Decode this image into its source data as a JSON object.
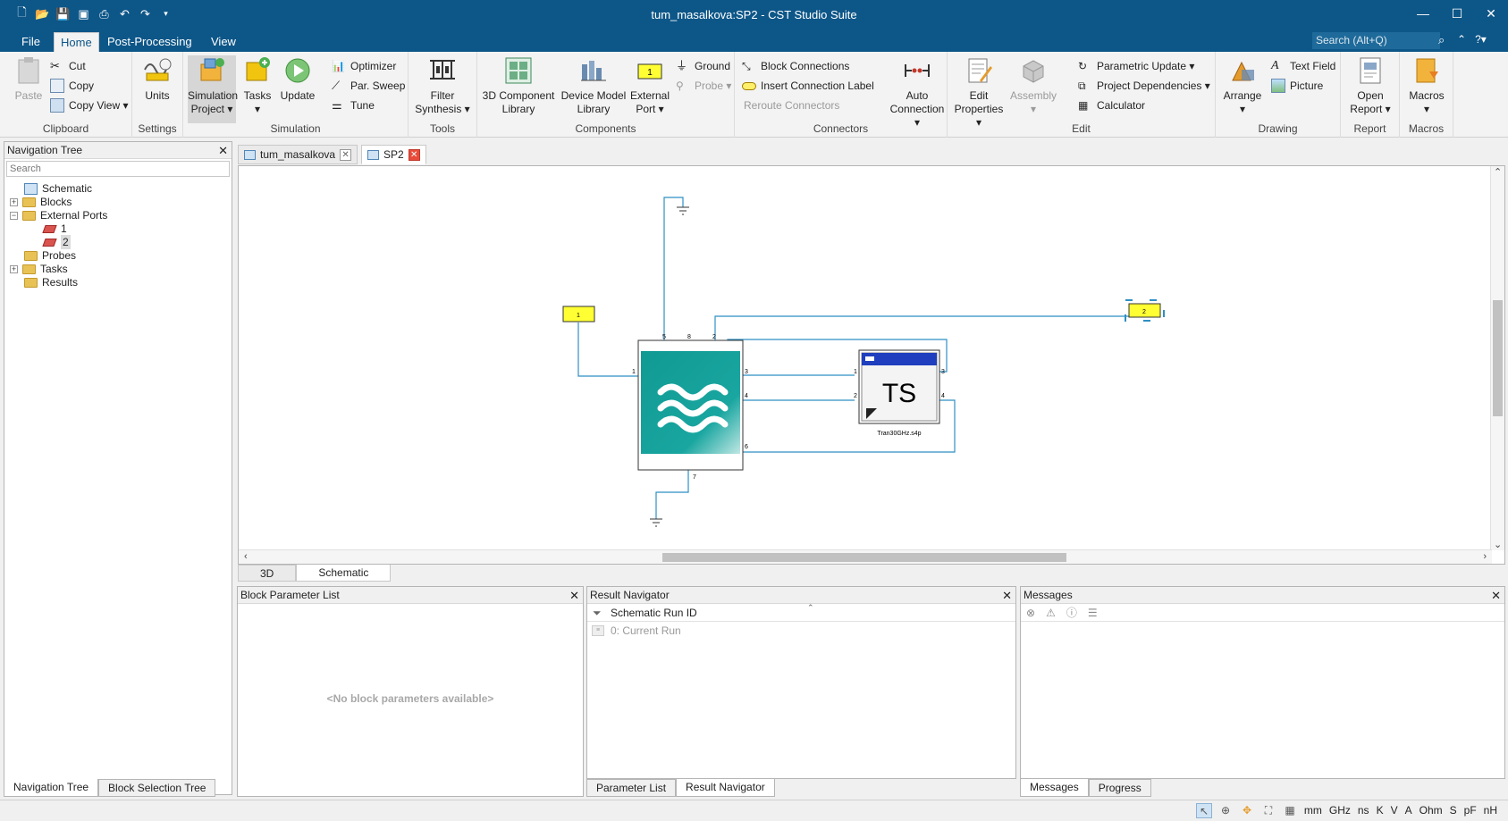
{
  "window": {
    "title": "tum_masalkova:SP2 - CST Studio Suite"
  },
  "menu": {
    "tabs": [
      "File",
      "Home",
      "Post-Processing",
      "View"
    ],
    "active": "Home",
    "search_placeholder": "Search (Alt+Q)"
  },
  "ribbon": {
    "clipboard": {
      "paste": "Paste",
      "cut": "Cut",
      "copy": "Copy",
      "copy_view": "Copy View",
      "label": "Clipboard"
    },
    "settings": {
      "units": "Units",
      "label": "Settings"
    },
    "simulation": {
      "sim_project_1": "Simulation",
      "sim_project_2": "Project",
      "tasks": "Tasks",
      "update": "Update",
      "optimizer": "Optimizer",
      "par_sweep": "Par. Sweep",
      "tune": "Tune",
      "label": "Simulation"
    },
    "tools": {
      "filter_1": "Filter",
      "filter_2": "Synthesis",
      "label": "Tools"
    },
    "components": {
      "lib3d_1": "3D Component",
      "lib3d_2": "Library",
      "dev_1": "Device Model",
      "dev_2": "Library",
      "ext_1": "External",
      "ext_2": "Port",
      "ground": "Ground",
      "probe": "Probe",
      "label": "Components"
    },
    "connectors": {
      "block_conn": "Block Connections",
      "insert_label": "Insert Connection Label",
      "reroute": "Reroute Connectors",
      "auto_1": "Auto",
      "auto_2": "Connection",
      "label": "Connectors"
    },
    "edit": {
      "edit_1": "Edit",
      "edit_2": "Properties",
      "assembly": "Assembly",
      "param_update": "Parametric Update",
      "project_dep": "Project Dependencies",
      "calculator": "Calculator",
      "label": "Edit"
    },
    "drawing": {
      "arrange": "Arrange",
      "text_field": "Text Field",
      "picture": "Picture",
      "label": "Drawing"
    },
    "report": {
      "open_1": "Open",
      "open_2": "Report",
      "label": "Report"
    },
    "macros": {
      "macros": "Macros",
      "label": "Macros"
    }
  },
  "nav": {
    "title": "Navigation Tree",
    "search": "Search",
    "nodes": [
      "Schematic",
      "Blocks",
      "External Ports",
      "1",
      "2",
      "Probes",
      "Tasks",
      "Results"
    ],
    "tabs": [
      "Navigation Tree",
      "Block Selection Tree"
    ]
  },
  "doc_tabs": [
    "tum_masalkova",
    "SP2"
  ],
  "schematic": {
    "port1": "1",
    "port2": "2",
    "ts_block_text": "TS",
    "ts_block_label": "Tran30GHz.s4p",
    "filter_pins": [
      "1",
      "5",
      "8",
      "2",
      "3",
      "4",
      "6",
      "7"
    ],
    "ts_pins": [
      "1",
      "2",
      "3",
      "4"
    ]
  },
  "view_tabs": [
    "3D",
    "Schematic"
  ],
  "bpl": {
    "title": "Block Parameter List",
    "empty": "<No block parameters available>"
  },
  "rnav": {
    "title": "Result Navigator",
    "header": "Schematic Run ID",
    "row": "0: Current Run",
    "tabs": [
      "Parameter List",
      "Result Navigator"
    ]
  },
  "msgs": {
    "title": "Messages",
    "tabs": [
      "Messages",
      "Progress"
    ]
  },
  "status": {
    "units": [
      "mm",
      "GHz",
      "ns",
      "K",
      "V",
      "A",
      "Ohm",
      "S",
      "pF",
      "nH"
    ]
  }
}
